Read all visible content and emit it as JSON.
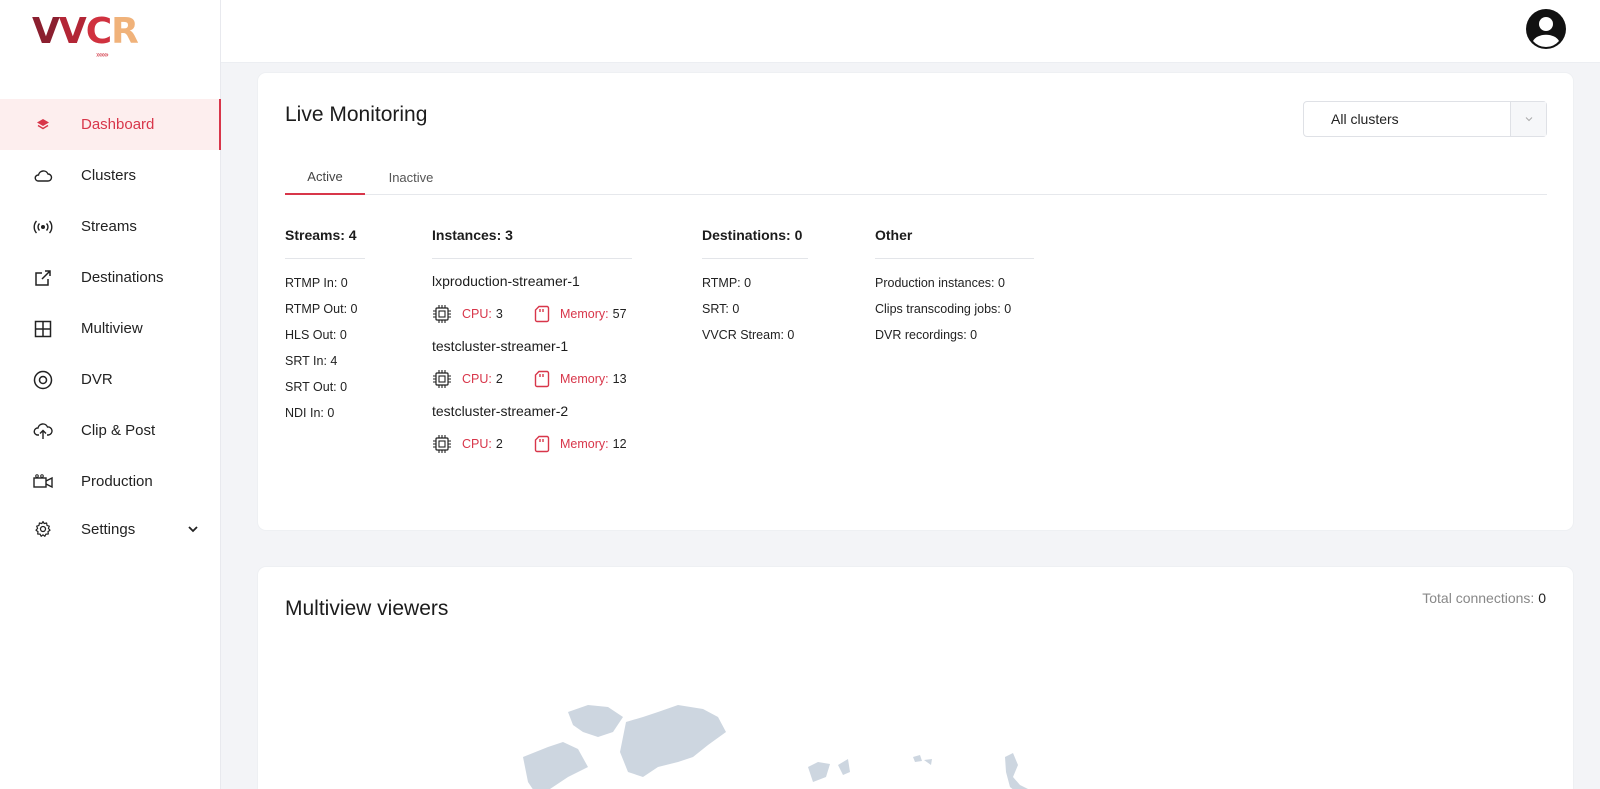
{
  "brand": {
    "name": "VVCR",
    "letters": [
      "V",
      "V",
      "C",
      "R"
    ],
    "arrows": "›››››››"
  },
  "sidebar": {
    "items": [
      {
        "label": "Dashboard",
        "icon": "layers-icon",
        "active": true
      },
      {
        "label": "Clusters",
        "icon": "cloud-icon"
      },
      {
        "label": "Streams",
        "icon": "broadcast-icon"
      },
      {
        "label": "Destinations",
        "icon": "external-link-icon"
      },
      {
        "label": "Multiview",
        "icon": "grid-icon"
      },
      {
        "label": "DVR",
        "icon": "disc-icon"
      },
      {
        "label": "Clip & Post",
        "icon": "cloud-upload-icon"
      },
      {
        "label": "Production",
        "icon": "video-camera-icon"
      },
      {
        "label": "Settings",
        "icon": "gear-icon",
        "expandable": true
      }
    ]
  },
  "header": {
    "avatar_icon": "user-avatar-icon"
  },
  "live_monitoring": {
    "title": "Live Monitoring",
    "cluster_select": {
      "value": "All clusters"
    },
    "tabs": [
      {
        "label": "Active",
        "active": true
      },
      {
        "label": "Inactive"
      }
    ],
    "streams": {
      "heading": "Streams: 4",
      "items": [
        "RTMP In: 0",
        "RTMP Out: 0",
        "HLS Out: 0",
        "SRT In: 4",
        "SRT Out: 0",
        "NDI In: 0"
      ]
    },
    "instances": {
      "heading": "Instances: 3",
      "cpu_label": "CPU:",
      "memory_label": "Memory:",
      "items": [
        {
          "name": "lxproduction-streamer-1",
          "cpu": "3",
          "memory": "57"
        },
        {
          "name": "testcluster-streamer-1",
          "cpu": "2",
          "memory": "13"
        },
        {
          "name": "testcluster-streamer-2",
          "cpu": "2",
          "memory": "12"
        }
      ]
    },
    "destinations": {
      "heading": "Destinations: 0",
      "items": [
        "RTMP: 0",
        "SRT: 0",
        "VVCR Stream: 0"
      ]
    },
    "other": {
      "heading": "Other",
      "items": [
        "Production instances: 0",
        "Clips transcoding jobs: 0",
        "DVR recordings: 0"
      ]
    }
  },
  "multiview_viewers": {
    "title": "Multiview viewers",
    "total_label": "Total connections:",
    "total_value": "0"
  },
  "colors": {
    "accent": "#d8364a",
    "active_bg": "#fdeeee",
    "map": "#cdd6e0"
  }
}
